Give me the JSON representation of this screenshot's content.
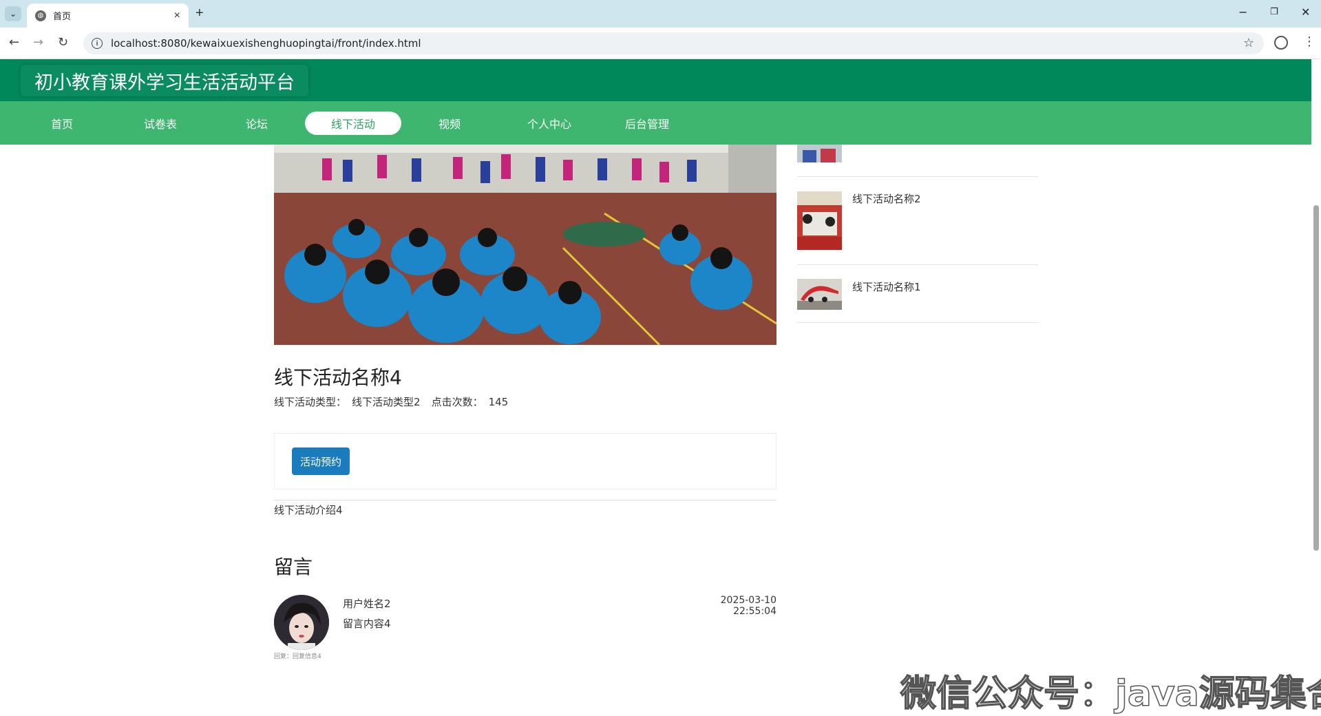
{
  "browser": {
    "tab_title": "首页",
    "url": "localhost:8080/kewaixuexishenghuopingtai/front/index.html"
  },
  "site": {
    "brand": "初小教育课外学习生活活动平台",
    "nav": [
      {
        "label": "首页"
      },
      {
        "label": "试卷表"
      },
      {
        "label": "论坛"
      },
      {
        "label": "线下活动",
        "active": true
      },
      {
        "label": "视频"
      },
      {
        "label": "个人中心"
      },
      {
        "label": "后台管理"
      }
    ],
    "accent_dark": "#00875a",
    "accent_light": "#3fb66f",
    "button_blue": "#1a7bbd"
  },
  "activity": {
    "title": "线下活动名称4",
    "type_label": "线下活动类型：",
    "type_value": "线下活动类型2",
    "clicks_label": "点击次数：",
    "clicks_value": "145",
    "book_button": "活动预约",
    "intro": "线下活动介绍4"
  },
  "comments": {
    "heading": "留言",
    "items": [
      {
        "user": "用户姓名2",
        "content": "留言内容4",
        "time": "2025-03-10 22:55:04",
        "reply": "回复：回复信息4"
      }
    ]
  },
  "sidebar": {
    "items": [
      {
        "label": "线下活动名称2"
      },
      {
        "label": "线下活动名称1"
      }
    ]
  },
  "watermark": "微信公众号：java源码集合"
}
